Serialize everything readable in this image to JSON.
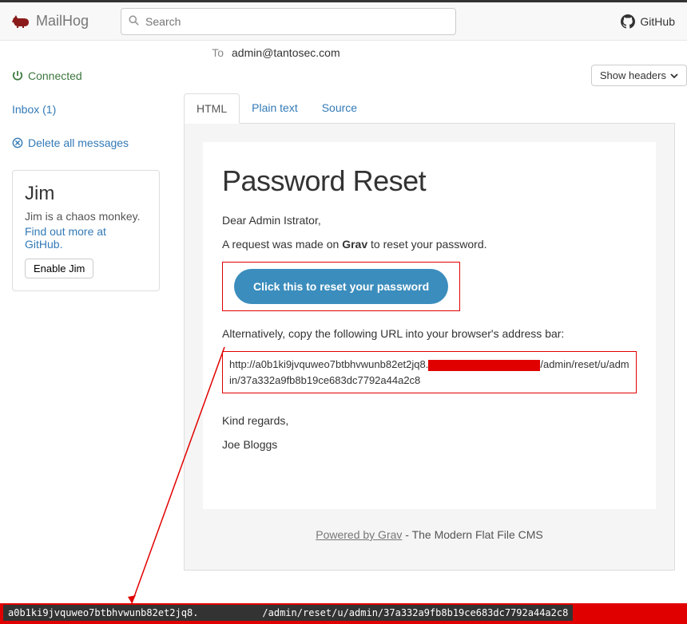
{
  "nav": {
    "brand": "MailHog",
    "search_placeholder": "Search",
    "github_label": "GitHub"
  },
  "sidebar": {
    "connected": "Connected",
    "inbox": "Inbox (1)",
    "delete_all": "Delete all messages",
    "jim": {
      "title": "Jim",
      "desc": "Jim is a chaos monkey.",
      "link1": "Find out more at",
      "link2": "GitHub.",
      "enable": "Enable Jim"
    }
  },
  "message": {
    "to_label": "To",
    "to_value": "admin@tantosec.com",
    "show_headers": "Show headers"
  },
  "tabs": {
    "html": "HTML",
    "plain": "Plain text",
    "source": "Source"
  },
  "email": {
    "title": "Password Reset",
    "greeting": "Dear Admin Istrator,",
    "line1a": "A request was made on ",
    "line1b": "Grav",
    "line1c": " to reset your password.",
    "button": "Click this to reset your password",
    "alt": "Alternatively, copy the following URL into your browser's address bar:",
    "url_a": "http://a0b1ki9jvquweo7btbhvwunb82et2jq8.",
    "url_b": "/admin/reset/u/admin/37a332a9fb8b19ce683dc7792a44a2c8",
    "regards": "Kind regards,",
    "signature": "Joe Bloggs",
    "footer_link": "Powered by Grav",
    "footer_rest": " - The Modern Flat File CMS"
  },
  "status": {
    "url_a": "a0b1ki9jvquweo7btbhvwunb82et2jq8.",
    "url_b": "/admin/reset/u/admin/37a332a9fb8b19ce683dc7792a44a2c8"
  }
}
